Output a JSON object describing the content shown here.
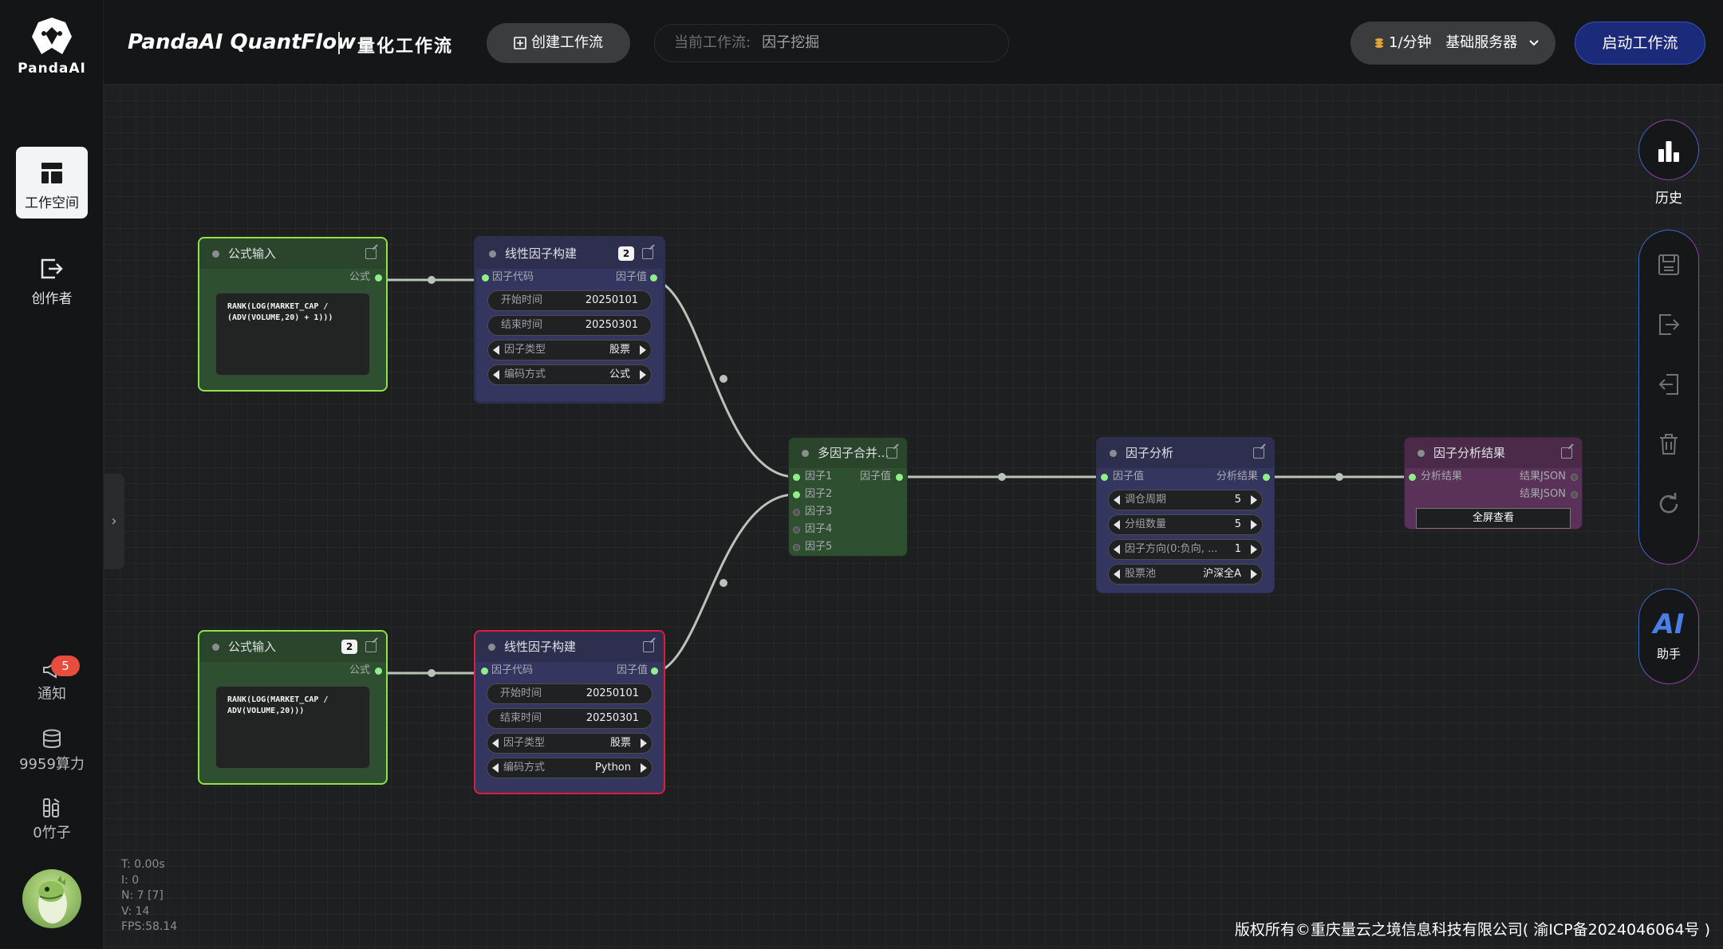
{
  "brand": {
    "logo_text": "PandaAI",
    "title": "PandaAI QuantFlow",
    "subtitle": "量化工作流"
  },
  "sidebar": {
    "items": [
      {
        "label": "工作空间",
        "icon": "layout-icon",
        "active": true
      },
      {
        "label": "创作者",
        "icon": "export-box-icon",
        "active": false
      }
    ],
    "notify": {
      "label": "通知",
      "icon": "megaphone-icon",
      "count": "5"
    },
    "compute": {
      "label": "9959算力",
      "icon": "database-icon"
    },
    "bamboo": {
      "label": "0竹子",
      "icon": "bamboo-icon"
    }
  },
  "header": {
    "create_button": "创建工作流",
    "current_flow_label": "当前工作流:",
    "current_flow_value": "因子挖掘",
    "server_price": "1/分钟",
    "server_name": "基础服务器",
    "start_button": "启动工作流"
  },
  "nodes": {
    "formula1": {
      "title": "公式输入",
      "output": "公式",
      "code_line1": "RANK(LOG(MARKET_CAP /",
      "code_line2": "(ADV(VOLUME,20) + 1)))"
    },
    "formula2": {
      "title": "公式输入",
      "badge": "2",
      "output": "公式",
      "code_line1": "RANK(LOG(MARKET_CAP /",
      "code_line2": "ADV(VOLUME,20)))"
    },
    "linear1": {
      "title": "线性因子构建",
      "badge": "2",
      "input": "因子代码",
      "output": "因子值",
      "start_label": "开始时间",
      "start_value": "20250101",
      "end_label": "结束时间",
      "end_value": "20250301",
      "type_label": "因子类型",
      "type_value": "股票",
      "encode_label": "编码方式",
      "encode_value": "公式"
    },
    "linear2": {
      "title": "线性因子构建",
      "input": "因子代码",
      "output": "因子值",
      "start_label": "开始时间",
      "start_value": "20250101",
      "end_label": "结束时间",
      "end_value": "20250301",
      "type_label": "因子类型",
      "type_value": "股票",
      "encode_label": "编码方式",
      "encode_value": "Python"
    },
    "merge": {
      "title": "多因子合并...",
      "inputs": [
        "因子1",
        "因子2",
        "因子3",
        "因子4",
        "因子5"
      ],
      "output": "因子值"
    },
    "analysis": {
      "title": "因子分析",
      "input": "因子值",
      "output": "分析结果",
      "period_label": "调仓周期",
      "period_value": "5",
      "groups_label": "分组数量",
      "groups_value": "5",
      "direction_label": "因子方向(0:负向, ...",
      "direction_value": "1",
      "pool_label": "股票池",
      "pool_value": "沪深全A"
    },
    "result": {
      "title": "因子分析结果",
      "input": "分析结果",
      "output1": "结果JSON",
      "output2": "结果JSON",
      "button": "全屏查看"
    }
  },
  "right_toolbar": {
    "history_label": "历史",
    "ai_text": "AI",
    "ai_label": "助手"
  },
  "stats": {
    "t": "T: 0.00s",
    "i": "I: 0",
    "n": "N: 7 [7]",
    "v": "V: 14",
    "fps": "FPS:58.14"
  },
  "footer": "版权所有©重庆量云之境信息科技有限公司( 渝ICP备2024046064号 )",
  "colors": {
    "accent": "#1c2a7a",
    "selected_green": "#8fe24a",
    "error_red": "#e21b3c",
    "link": "#b8c4b8"
  }
}
